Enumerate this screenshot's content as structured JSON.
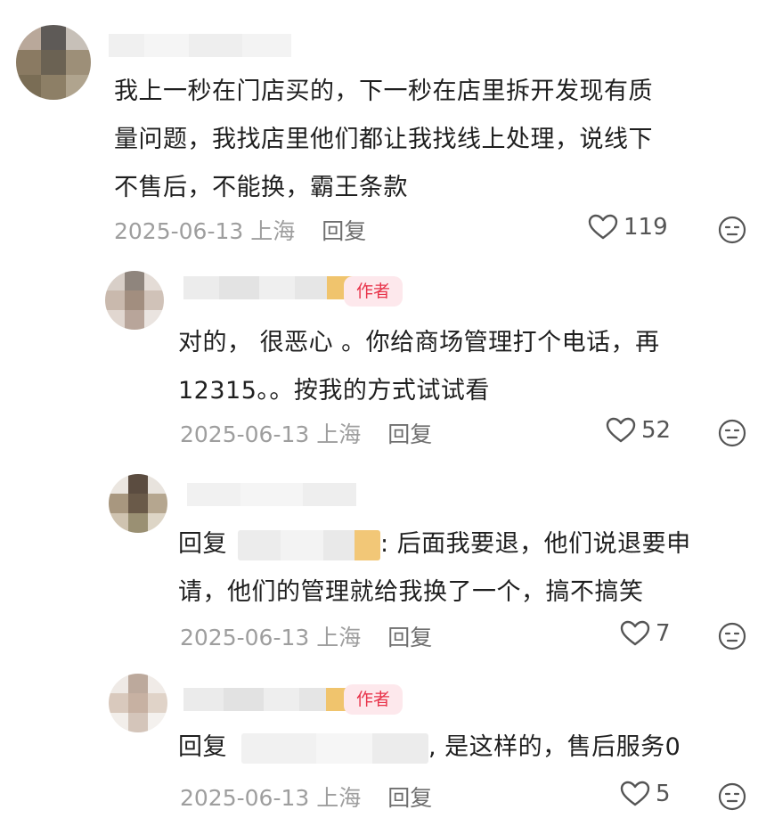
{
  "comments": [
    {
      "text_lines": [
        "我上一秒在门店买的，下一秒在店里拆开发现有质",
        "量问题，我找店里他们都让我找线上处理，说线下",
        "不售后，不能换，霸王条款"
      ],
      "date": "2025-06-13",
      "location": "上海",
      "reply_label": "回复",
      "likes": "119"
    },
    {
      "tag": "作者",
      "text_lines": [
        "对的， 很恶心 。你给商场管理打个电话，再",
        "12315。。按我的方式试试看"
      ],
      "date": "2025-06-13",
      "location": "上海",
      "reply_label": "回复",
      "likes": "52"
    },
    {
      "reply_prefix": "回复",
      "text_line1_rest": ": 后面我要退，他们说退要申",
      "text_line2": "请，他们的管理就给我换了一个，搞不搞笑",
      "date": "2025-06-13",
      "location": "上海",
      "reply_label": "回复",
      "likes": "7"
    },
    {
      "tag": "作者",
      "reply_prefix": "回复",
      "text_rest": ", 是这样的，售后服务0",
      "date": "2025-06-13",
      "location": "上海",
      "reply_label": "回复",
      "likes": "5"
    }
  ],
  "icons": {
    "like": "heart-outline-icon",
    "dislike": "meh-face-icon"
  },
  "colors": {
    "tag_bg": "#fde8ec",
    "tag_text": "#e8334a",
    "meta": "#9e9e9e"
  }
}
